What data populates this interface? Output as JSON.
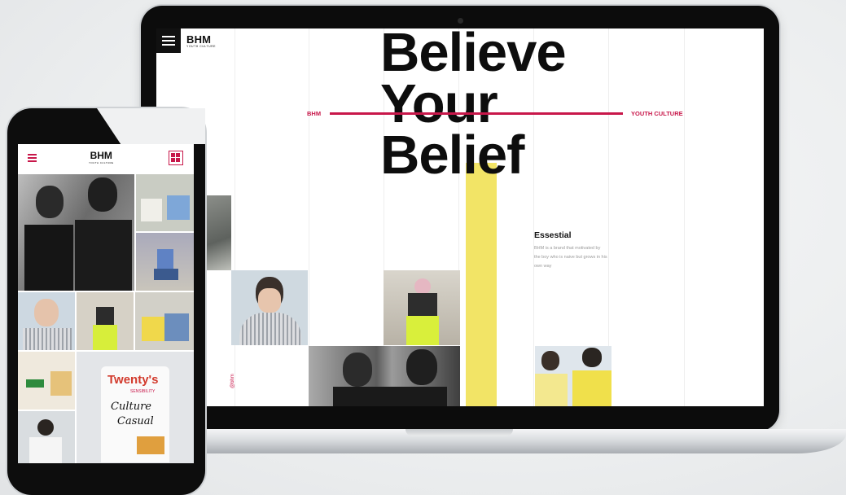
{
  "desktop": {
    "brand": "BHM",
    "brand_sub": "YOUTH CULTURE",
    "headline": [
      "Believe",
      "Your",
      "Belief"
    ],
    "tag_left": "BHM",
    "tag_right": "YOUTH CULTURE",
    "essential_title": "Essestial",
    "essential_body": "BHM is a brand that motivated by the boy who is naive but grows in his own way",
    "vertical_text": "@bhm",
    "accent_color": "#c8174a",
    "highlight_color": "#f2e466"
  },
  "mobile": {
    "brand": "BHM",
    "brand_sub": "YOUTH CULTURE",
    "shirt_text": [
      "Twenty's",
      "SENSIBILITY",
      "Culture",
      "Casual"
    ]
  },
  "icons": [
    "hamburger-menu-icon",
    "grid-view-icon"
  ]
}
